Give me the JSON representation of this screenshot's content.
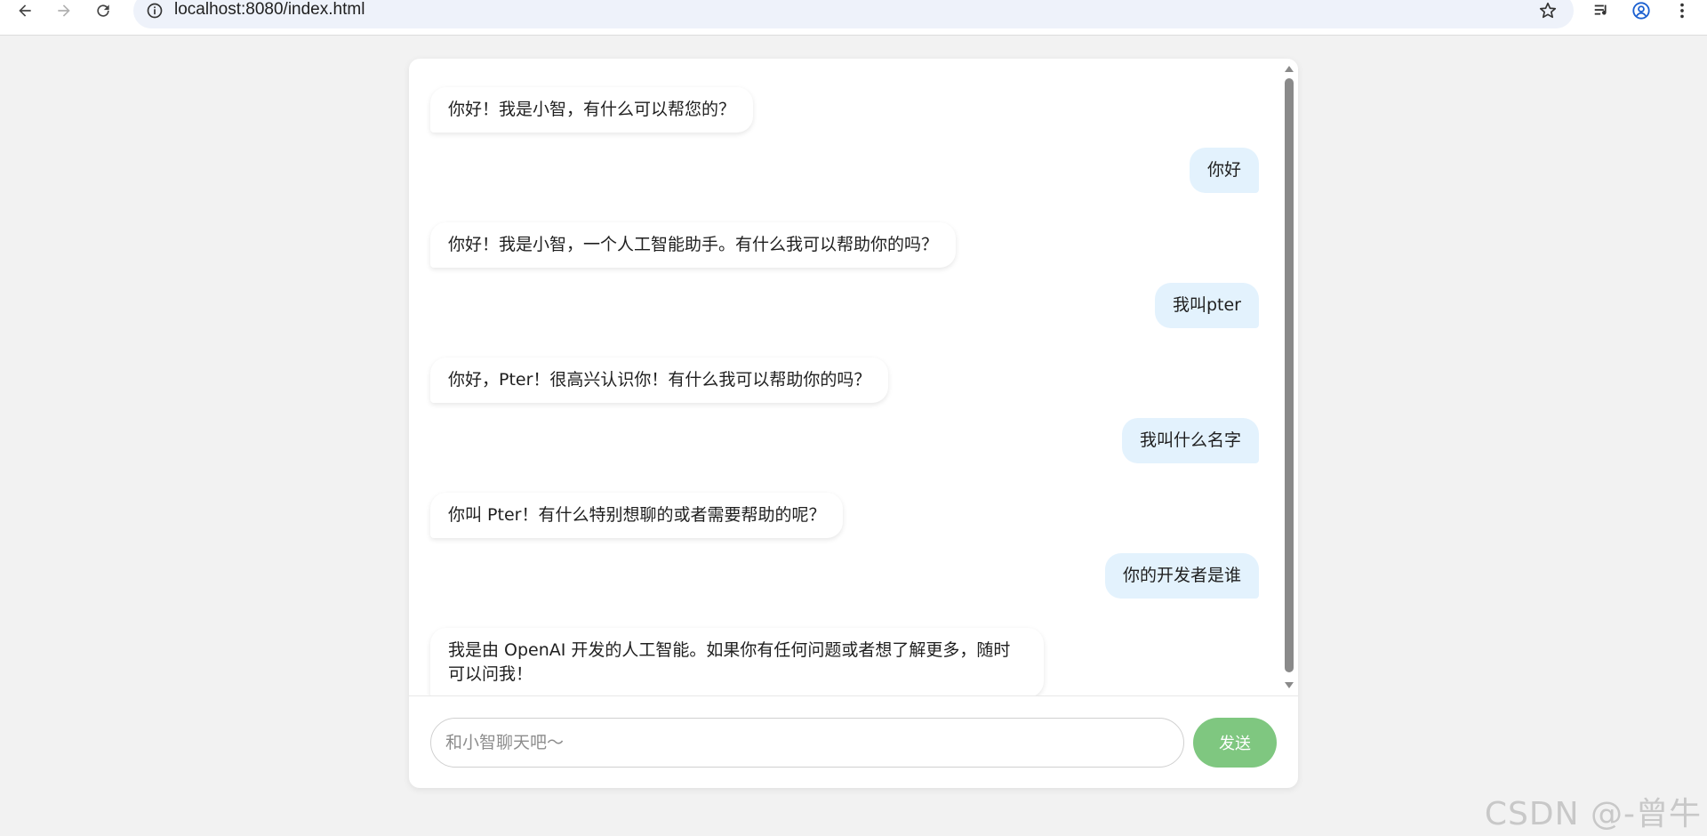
{
  "browser": {
    "url": "localhost:8080/index.html",
    "icons": [
      "back-icon",
      "forward-icon",
      "reload-icon",
      "site-info-icon",
      "bookmark-star-icon",
      "reading-list-icon",
      "profile-icon",
      "menu-icon"
    ]
  },
  "chat": {
    "messages": [
      {
        "role": "bot",
        "text": "你好！我是小智，有什么可以帮您的？"
      },
      {
        "role": "user",
        "text": "你好"
      },
      {
        "role": "bot",
        "text": "你好！我是小智，一个人工智能助手。有什么我可以帮助你的吗？"
      },
      {
        "role": "user",
        "text": "我叫pter"
      },
      {
        "role": "bot",
        "text": "你好，Pter！很高兴认识你！有什么我可以帮助你的吗？"
      },
      {
        "role": "user",
        "text": "我叫什么名字"
      },
      {
        "role": "bot",
        "text": "你叫 Pter！有什么特别想聊的或者需要帮助的呢？"
      },
      {
        "role": "user",
        "text": "你的开发者是谁"
      },
      {
        "role": "bot",
        "text": "我是由 OpenAI 开发的人工智能。如果你有任何问题或者想了解更多，随时可以问我！"
      }
    ],
    "input_placeholder": "和小智聊天吧～",
    "send_label": "发送"
  },
  "colors": {
    "user_bubble": "#e3f2fd",
    "bot_bubble": "#ffffff",
    "send_button": "#7fc780",
    "page_background": "#f2f2f2"
  },
  "watermark": "CSDN @-曾牛"
}
